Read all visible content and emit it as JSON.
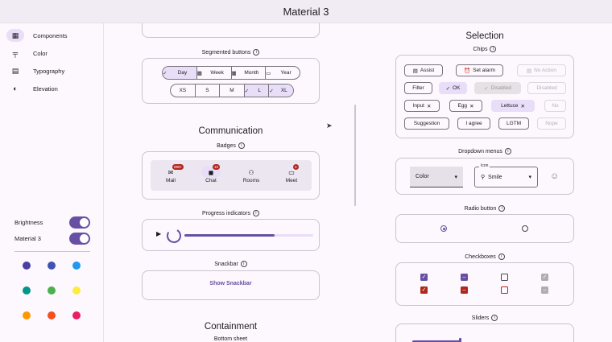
{
  "window": {
    "title": "Material 3"
  },
  "sidebar": {
    "items": [
      {
        "label": "Components",
        "icon": "widgets-icon",
        "active": true
      },
      {
        "label": "Color",
        "icon": "format-paint-icon",
        "active": false
      },
      {
        "label": "Typography",
        "icon": "article-icon",
        "active": false
      },
      {
        "label": "Elevation",
        "icon": "contrast-icon",
        "active": false
      }
    ],
    "brightness_label": "Brightness",
    "material3_label": "Material 3",
    "colors": [
      "#4a3fa3",
      "#3f51b5",
      "#2196f3",
      "#009688",
      "#4caf50",
      "#ffeb3b",
      "#ff9800",
      "#f4511e",
      "#e91e63"
    ]
  },
  "left": {
    "segmented_label": "Segmented buttons",
    "segmented_row1": [
      "Day",
      "Week",
      "Month",
      "Year"
    ],
    "segmented_row2": [
      "XS",
      "S",
      "M",
      "L",
      "XL"
    ],
    "communication_title": "Communication",
    "badges_label": "Badges",
    "badges": [
      {
        "label": "Mail",
        "badge": "999+"
      },
      {
        "label": "Chat",
        "badge": "10"
      },
      {
        "label": "Rooms",
        "badge": ""
      },
      {
        "label": "Meet",
        "badge": "3"
      }
    ],
    "progress_label": "Progress indicators",
    "snackbar_label": "Snackbar",
    "snackbar_button": "Show Snackbar",
    "containment_title": "Containment",
    "bottom_sheet_label": "Bottom sheet"
  },
  "right": {
    "selection_title": "Selection",
    "chips_label": "Chips",
    "chips_row1": [
      "Assist",
      "Set alarm",
      "No Action"
    ],
    "chips_row2": [
      "Filter",
      "OK",
      "Disabled",
      "Disabled"
    ],
    "chips_row3": [
      "Input",
      "Egg",
      "Lettuce",
      "No"
    ],
    "chips_row4": [
      "Suggestion",
      "I agree",
      "LGTM",
      "Nope"
    ],
    "dropdown_label": "Dropdown menus",
    "dropdown_color": "Color",
    "dropdown_icon_label": "Icon",
    "dropdown_icon_value": "Smile",
    "radio_label": "Radio button",
    "checkbox_label": "Checkboxes",
    "sliders_label": "Sliders"
  }
}
